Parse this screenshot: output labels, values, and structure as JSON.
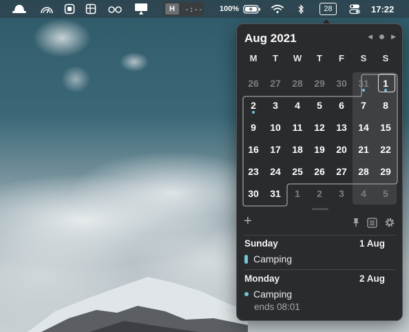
{
  "menubar": {
    "hotkey_label": "H",
    "hotkey_time": "-:--",
    "battery": "100%",
    "calendar_day": "28",
    "clock": "17:22",
    "icons": [
      "weather-hat-icon",
      "gauge-icon",
      "app-square-icon",
      "grid-icon",
      "glasses-icon",
      "display-icon",
      "battery-charging-icon",
      "wifi-icon",
      "bluetooth-icon",
      "control-center-icon"
    ]
  },
  "calendar": {
    "month_title": "Aug 2021",
    "weekdays": [
      "M",
      "T",
      "W",
      "T",
      "F",
      "S",
      "S"
    ],
    "weeks": [
      [
        {
          "d": "26",
          "dim": true
        },
        {
          "d": "27",
          "dim": true
        },
        {
          "d": "28",
          "dim": true
        },
        {
          "d": "29",
          "dim": true
        },
        {
          "d": "30",
          "dim": true
        },
        {
          "d": "31",
          "dim": true,
          "event": true
        },
        {
          "d": "1",
          "event": true,
          "today": true
        }
      ],
      [
        {
          "d": "2",
          "event": true
        },
        {
          "d": "3"
        },
        {
          "d": "4"
        },
        {
          "d": "5"
        },
        {
          "d": "6"
        },
        {
          "d": "7"
        },
        {
          "d": "8"
        }
      ],
      [
        {
          "d": "9"
        },
        {
          "d": "10"
        },
        {
          "d": "11"
        },
        {
          "d": "12"
        },
        {
          "d": "13"
        },
        {
          "d": "14"
        },
        {
          "d": "15"
        }
      ],
      [
        {
          "d": "16"
        },
        {
          "d": "17"
        },
        {
          "d": "18"
        },
        {
          "d": "19"
        },
        {
          "d": "20"
        },
        {
          "d": "21"
        },
        {
          "d": "22"
        }
      ],
      [
        {
          "d": "23"
        },
        {
          "d": "24"
        },
        {
          "d": "25"
        },
        {
          "d": "26"
        },
        {
          "d": "27"
        },
        {
          "d": "28"
        },
        {
          "d": "29"
        }
      ],
      [
        {
          "d": "30"
        },
        {
          "d": "31"
        },
        {
          "d": "1",
          "dim": true
        },
        {
          "d": "2",
          "dim": true
        },
        {
          "d": "3",
          "dim": true
        },
        {
          "d": "4",
          "dim": true
        },
        {
          "d": "5",
          "dim": true
        }
      ]
    ],
    "accent": "#73c6dc"
  },
  "events": {
    "day1": {
      "weekday": "Sunday",
      "date": "1 Aug",
      "title": "Camping"
    },
    "day2": {
      "weekday": "Monday",
      "date": "2 Aug",
      "title": "Camping",
      "subtitle": "ends 08:01"
    }
  }
}
